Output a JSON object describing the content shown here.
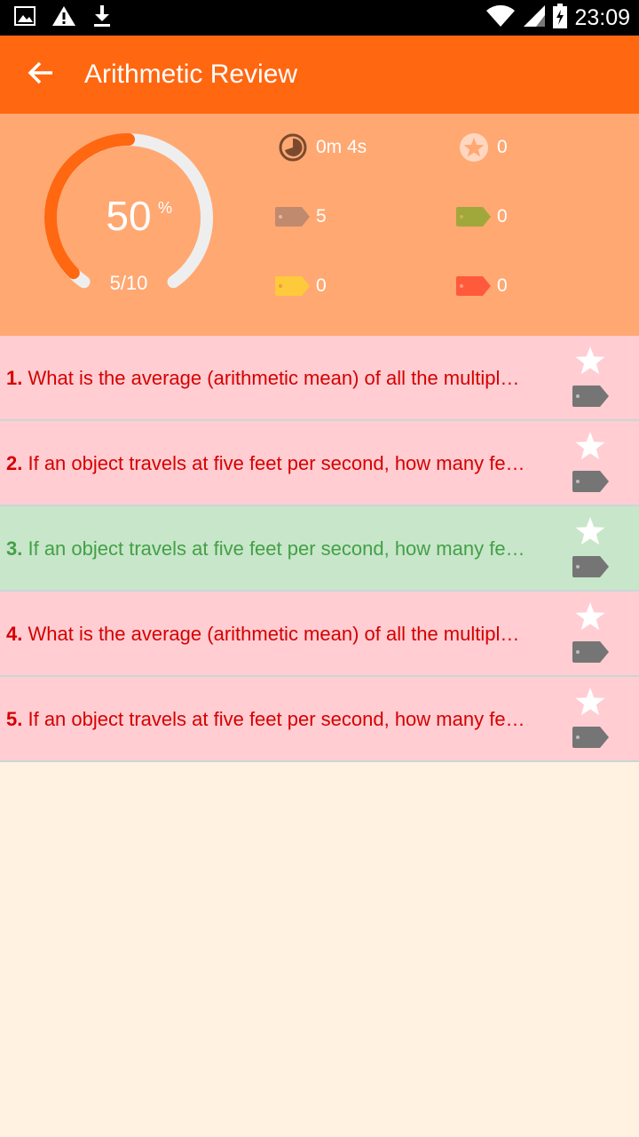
{
  "status_bar": {
    "time": "23:09"
  },
  "app_bar": {
    "title": "Arithmetic Review"
  },
  "summary": {
    "percent": "50",
    "percent_sign": "%",
    "fraction": "5/10",
    "progress": 0.5,
    "time_spent": "0m 4s",
    "starred_count": "0",
    "tag_brown_count": "5",
    "tag_green_count": "0",
    "tag_yellow_count": "0",
    "tag_red_count": "0"
  },
  "questions": [
    {
      "number": "1.",
      "text": "What is the average (arithmetic mean) of all the multipl…",
      "status": "wrong"
    },
    {
      "number": "2.",
      "text": "If an object travels at five feet per second, how many fe…",
      "status": "wrong"
    },
    {
      "number": "3.",
      "text": "If an object travels at five feet per second, how many fe…",
      "status": "right"
    },
    {
      "number": "4.",
      "text": "What is the average (arithmetic mean) of all the multipl…",
      "status": "wrong"
    },
    {
      "number": "5.",
      "text": "If an object travels at five feet per second, how many fe…",
      "status": "wrong"
    }
  ],
  "colors": {
    "app_bar": "#ff6711",
    "summary_bg": "#ffa872",
    "wrong_bg": "#ffcdd2",
    "right_bg": "#c8e6c9",
    "wrong_text": "#d50000",
    "right_text": "#43a047",
    "page_bg": "#fff2e0",
    "gauge_fill": "#ff6711",
    "gauge_track": "#eeeeee"
  },
  "icons": {
    "status_left": [
      "image-icon",
      "warning-icon",
      "download-icon"
    ],
    "status_right": [
      "wifi-icon",
      "signal-icon",
      "battery-icon"
    ],
    "back": "arrow-left-icon",
    "timer": "timer-icon",
    "star": "star-icon",
    "tag": "tag-icon"
  }
}
